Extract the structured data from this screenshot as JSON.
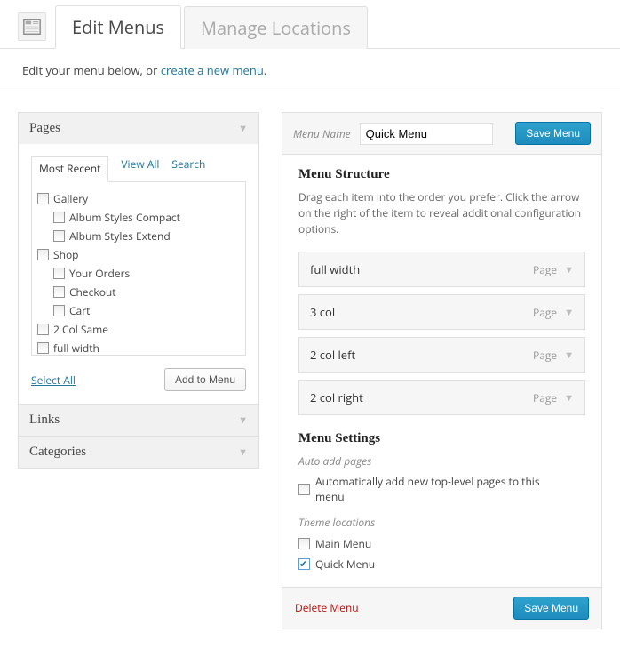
{
  "tabs": {
    "edit": "Edit Menus",
    "manage": "Manage Locations"
  },
  "intro": {
    "prefix": "Edit your menu below, or ",
    "link": "create a new menu",
    "suffix": "."
  },
  "accordions": {
    "pages": "Pages",
    "links": "Links",
    "categories": "Categories"
  },
  "subtabs": {
    "recent": "Most Recent",
    "all": "View All",
    "search": "Search"
  },
  "pages": [
    {
      "label": "Gallery",
      "indent": 0
    },
    {
      "label": "Album Styles Compact",
      "indent": 1
    },
    {
      "label": "Album Styles Extend",
      "indent": 1
    },
    {
      "label": "Shop",
      "indent": 0
    },
    {
      "label": "Your Orders",
      "indent": 1
    },
    {
      "label": "Checkout",
      "indent": 1
    },
    {
      "label": "Cart",
      "indent": 1
    },
    {
      "label": "2 Col Same",
      "indent": 0
    },
    {
      "label": "full width",
      "indent": 0
    }
  ],
  "select_all": "Select All",
  "add_to_menu": "Add to Menu",
  "menu_name_label": "Menu Name",
  "menu_name_value": "Quick Menu",
  "save_menu": "Save Menu",
  "structure": {
    "heading": "Menu Structure",
    "desc": "Drag each item into the order you prefer. Click the arrow on the right of the item to reveal additional configuration options.",
    "items": [
      {
        "label": "full width",
        "type": "Page"
      },
      {
        "label": "3 col",
        "type": "Page"
      },
      {
        "label": "2 col left",
        "type": "Page"
      },
      {
        "label": "2 col right",
        "type": "Page"
      }
    ]
  },
  "settings": {
    "heading": "Menu Settings",
    "auto_label": "Auto add pages",
    "auto_check": "Automatically add new top-level pages to this menu",
    "theme_label": "Theme locations",
    "loc1": "Main Menu",
    "loc2": "Quick Menu"
  },
  "delete_menu": "Delete Menu"
}
